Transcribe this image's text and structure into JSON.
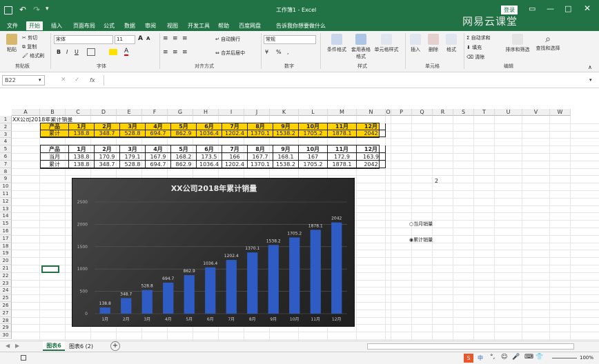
{
  "titlebar": {
    "title": "工作簿1 - Excel",
    "login": "登录",
    "watermark": "网易云课堂"
  },
  "tabs": [
    {
      "label": "文件"
    },
    {
      "label": "开始"
    },
    {
      "label": "插入"
    },
    {
      "label": "页面布局"
    },
    {
      "label": "公式"
    },
    {
      "label": "数据"
    },
    {
      "label": "审阅"
    },
    {
      "label": "视图"
    },
    {
      "label": "开发工具"
    },
    {
      "label": "帮助"
    },
    {
      "label": "百度网盘"
    },
    {
      "label": "告诉我你想要做什么"
    }
  ],
  "ribbon": {
    "paste": "粘贴",
    "cut": "剪切",
    "copy": "复制",
    "format_painter": "格式刷",
    "font_name": "宋体",
    "font_size": "11",
    "wrap": "自动换行",
    "merge": "合并后居中",
    "number_format": "常规",
    "cond_format": "条件格式",
    "table_format": "套用表格格式",
    "cell_style": "单元格样式",
    "insert": "插入",
    "delete": "删除",
    "format": "格式",
    "autosum": "自动求和",
    "fill": "填充",
    "clear": "清除",
    "sort": "排序和筛选",
    "find": "查找和选择",
    "groups": {
      "clipboard": "剪贴板",
      "font": "字体",
      "align": "对齐方式",
      "number": "数字",
      "style": "样式",
      "cells": "单元格",
      "editing": "编辑"
    }
  },
  "formula_bar": {
    "name_box": "B22",
    "fx": "fx",
    "value": ""
  },
  "columns": [
    "A",
    "B",
    "C",
    "D",
    "E",
    "F",
    "G",
    "H",
    "I",
    "J",
    "K",
    "L",
    "M",
    "N",
    "O",
    "P",
    "Q",
    "R",
    "S",
    "T",
    "U",
    "V",
    "W"
  ],
  "rows": [
    "1",
    "2",
    "3",
    "4",
    "5",
    "6",
    "7",
    "8",
    "9",
    "10",
    "11",
    "12",
    "13",
    "14",
    "15",
    "16",
    "17",
    "18",
    "19",
    "20",
    "21",
    "22",
    "23",
    "24",
    "25",
    "26",
    "27",
    "28",
    "29",
    "30"
  ],
  "sheet": {
    "a1": "XX公司2018年累计销量",
    "table1": {
      "header": [
        "产品",
        "1月",
        "2月",
        "3月",
        "4月",
        "5月",
        "6月",
        "7月",
        "8月",
        "9月",
        "10月",
        "11月",
        "12月"
      ],
      "row": [
        "累计",
        "138.8",
        "348.7",
        "528.8",
        "694.7",
        "862.9",
        "1036.4",
        "1202.4",
        "1370.1",
        "1538.2",
        "1705.2",
        "1878.1",
        "2042"
      ]
    },
    "table2": {
      "header": [
        "产品",
        "1月",
        "2月",
        "3月",
        "4月",
        "5月",
        "6月",
        "7月",
        "8月",
        "9月",
        "10月",
        "11月",
        "12月"
      ],
      "row1": [
        "当月",
        "138.8",
        "170.9",
        "179.1",
        "167.9",
        "168.2",
        "173.5",
        "166",
        "167.7",
        "168.1",
        "167",
        "172.9",
        "163.9"
      ],
      "row2": [
        "累计",
        "138.8",
        "348.7",
        "528.8",
        "694.7",
        "862.9",
        "1036.4",
        "1202.4",
        "1370.1",
        "1538.2",
        "1705.2",
        "1878.1",
        "2042"
      ]
    },
    "p9": "2",
    "radio1": "当月销量",
    "radio2": "累计销量"
  },
  "chart_data": {
    "type": "bar",
    "title": "XX公司2018年累计销量",
    "categories": [
      "1月",
      "2月",
      "3月",
      "4月",
      "5月",
      "6月",
      "7月",
      "8月",
      "9月",
      "10月",
      "11月",
      "12月"
    ],
    "values": [
      138.8,
      348.7,
      528.8,
      694.7,
      862.9,
      1036.4,
      1202.4,
      1370.1,
      1538.2,
      1705.2,
      1878.1,
      2042
    ],
    "data_labels": [
      "138.8",
      "348.7",
      "528.8",
      "694.7",
      "862.9",
      "1036.4",
      "1202.4",
      "1370.1",
      "1538.2",
      "1705.2",
      "1878.1",
      "2042"
    ],
    "y_ticks": [
      "0",
      "500",
      "1000",
      "1500",
      "2000",
      "2500"
    ],
    "ylim": [
      0,
      2500
    ],
    "grid": true,
    "bar_color": "#2f5bc4"
  },
  "sheet_tabs": [
    {
      "label": "图表6"
    },
    {
      "label": "图表6 (2)"
    }
  ],
  "status": {
    "zoom": "100%"
  }
}
